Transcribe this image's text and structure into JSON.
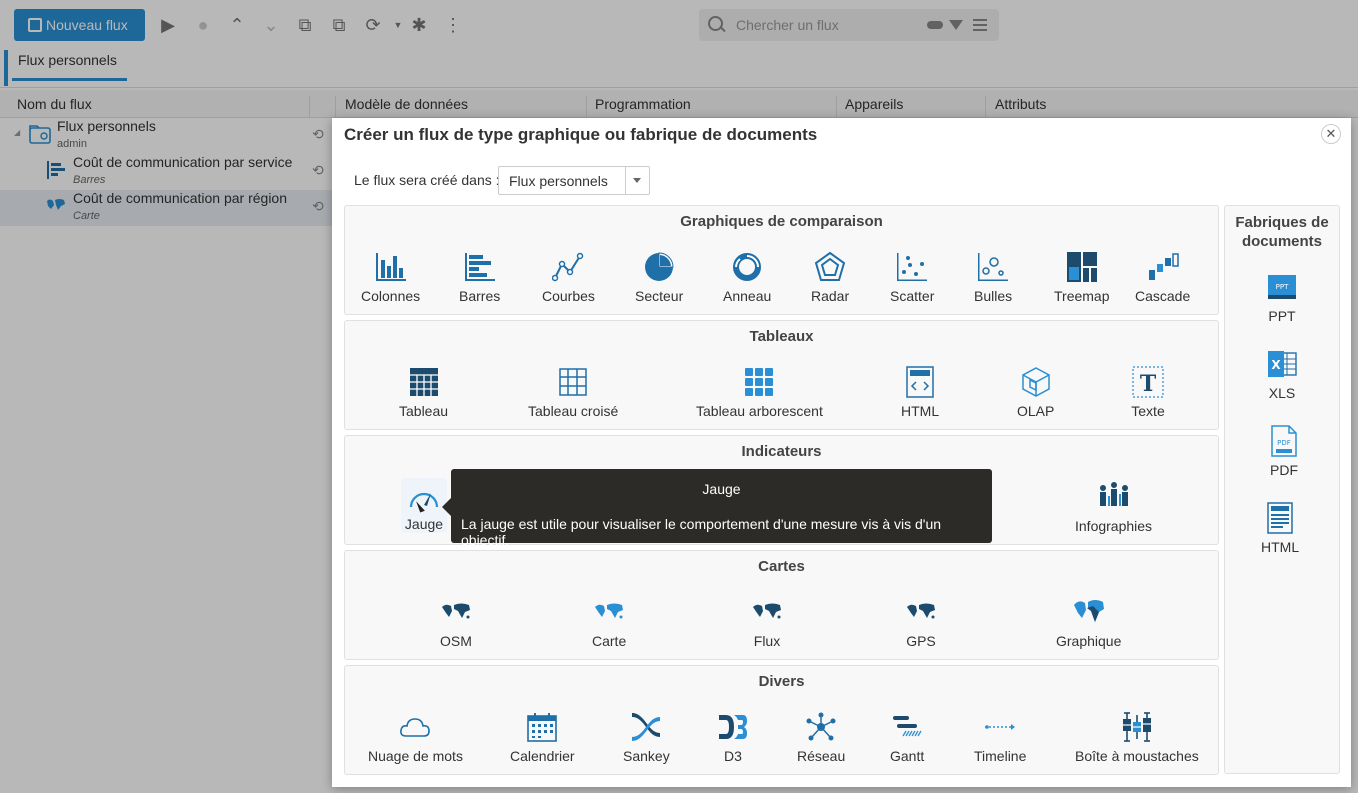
{
  "toolbar": {
    "new_flow_label": "Nouveau flux",
    "search_placeholder": "Chercher un flux"
  },
  "tabs": [
    {
      "label": "Flux personnels"
    }
  ],
  "columns": [
    "Nom du flux",
    "Modèle de données",
    "Programmation",
    "Appareils",
    "Attributs"
  ],
  "tree": [
    {
      "name": "Flux personnels",
      "sub": "admin",
      "icon": "folder-icon"
    },
    {
      "name": "Coût de communication par service",
      "sub": "Barres",
      "icon": "bar-chart-icon"
    },
    {
      "name": "Coût de communication par région",
      "sub": "Carte",
      "icon": "map-icon"
    }
  ],
  "modal": {
    "title": "Créer un flux de type graphique ou fabrique de documents",
    "location_label": "Le flux sera créé dans :",
    "location_value": "Flux personnels",
    "sections": {
      "comparaison": {
        "title": "Graphiques de comparaison",
        "items": [
          "Colonnes",
          "Barres",
          "Courbes",
          "Secteur",
          "Anneau",
          "Radar",
          "Scatter",
          "Bulles",
          "Treemap",
          "Cascade"
        ]
      },
      "tableaux": {
        "title": "Tableaux",
        "items": [
          "Tableau",
          "Tableau croisé",
          "Tableau arborescent",
          "HTML",
          "OLAP",
          "Texte"
        ]
      },
      "indicateurs": {
        "title": "Indicateurs",
        "items": [
          "Jauge",
          "Infographies"
        ]
      },
      "cartes": {
        "title": "Cartes",
        "items": [
          "OSM",
          "Carte",
          "Flux",
          "GPS",
          "Graphique"
        ]
      },
      "divers": {
        "title": "Divers",
        "items": [
          "Nuage de mots",
          "Calendrier",
          "Sankey",
          "D3",
          "Réseau",
          "Gantt",
          "Timeline",
          "Boîte à moustaches"
        ]
      }
    },
    "factories": {
      "title": "Fabriques de documents",
      "items": [
        "PPT",
        "XLS",
        "PDF",
        "HTML"
      ],
      "icon_texts": [
        "PPT",
        "X",
        "PDF"
      ]
    }
  },
  "tooltip": {
    "title": "Jauge",
    "description": "La jauge est utile pour visualiser le comportement d'une mesure vis à vis d'un objectif."
  },
  "colors": {
    "accent": "#2a8fd4",
    "icon": "#1f6fa8",
    "dark_icon": "#1d4b6e"
  }
}
